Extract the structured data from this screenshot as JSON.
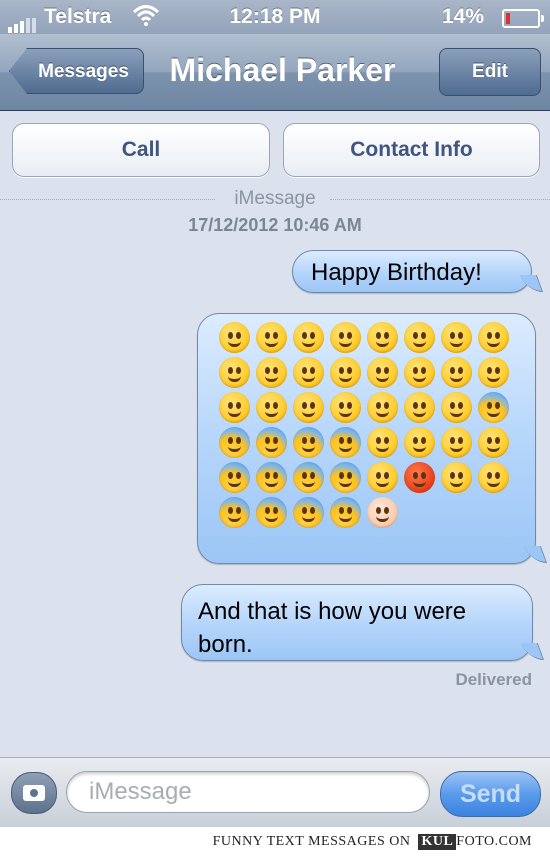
{
  "status_bar": {
    "carrier": "Telstra",
    "time": "12:18 PM",
    "battery": "14%",
    "battery_level": 0.14,
    "icons": [
      "signal-bars-icon",
      "wifi-icon",
      "battery-icon"
    ]
  },
  "nav": {
    "back_label": "Messages",
    "title": "Michael Parker",
    "edit_label": "Edit"
  },
  "actions": {
    "call_label": "Call",
    "contact_label": "Contact Info"
  },
  "conversation": {
    "service": "iMessage",
    "timestamp": "17/12/2012 10:46 AM",
    "messages": [
      {
        "text": "Happy Birthday!"
      },
      {
        "emoji_count": 45
      },
      {
        "text": "And that is how you were born."
      }
    ],
    "delivered": "Delivered"
  },
  "composer": {
    "placeholder": "iMessage",
    "value": "",
    "send_label": "Send"
  },
  "footer": {
    "prefix": "FUNNY TEXT MESSAGES ON",
    "brand": "KUL",
    "suffix": "FOTO.COM"
  },
  "colors": {
    "navbar": "#6d86a3",
    "bubble": "#b6d6fb",
    "send": "#3b82e0"
  }
}
